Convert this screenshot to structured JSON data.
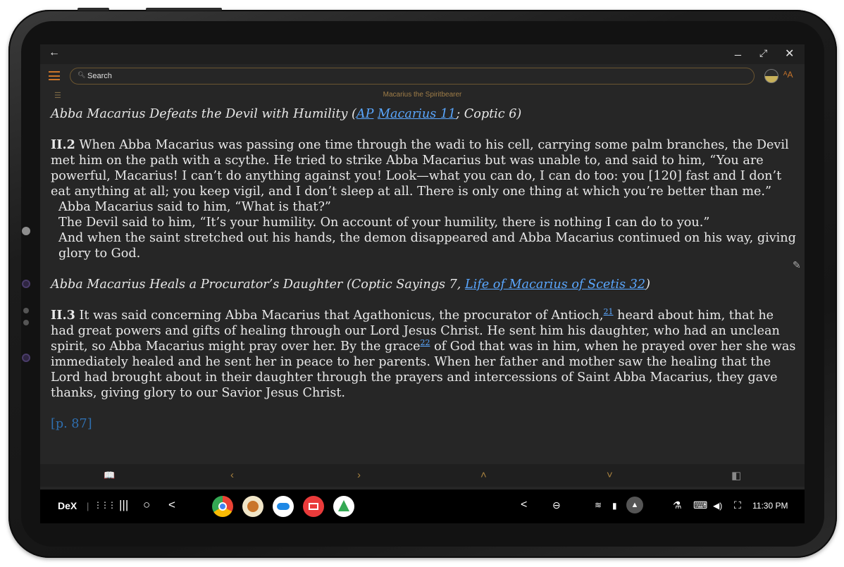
{
  "app": {
    "back_icon": "←",
    "window_buttons": {
      "minimize": "_",
      "maximize": "⤢",
      "close": "✕"
    },
    "search_placeholder": "Search",
    "book_title": "Macarius the Spiritbearer"
  },
  "sections": [
    {
      "heading_pre": "Abba Macarius Defeats the Devil with Humility (",
      "link1": "AP",
      "link_sep": " ",
      "link2": "Macarius 11",
      "heading_post": "; Coptic 6)",
      "para_num": "II.2",
      "para_body": " When Abba Macarius was passing one time through the wadi to his cell, carrying some palm branches, the Devil met him on the path with a scythe. He tried to strike Abba Macarius but was unable to, and said to him, “You are powerful, Macarius! I can’t do anything against you! Look—what you can do, I can do too: you [120] fast and I don’t eat anything at all; you keep vigil, and I don’t sleep at all. There is only one thing at which you’re better than me.”",
      "line2": "Abba Macarius said to him, “What is that?”",
      "line3": "The Devil said to him, “It’s your humility. On account of your humility, there is nothing I can do to you.”",
      "line4": "And when the saint stretched out his hands, the demon disappeared and Abba Macarius continued on his way, giving glory to God."
    },
    {
      "heading_pre": "Abba Macarius Heals a Procurator’s Daughter (Coptic Sayings 7, ",
      "link": "Life of Macarius of Scetis 32",
      "heading_post": ")",
      "para_num": "II.3",
      "body_a": " It was said concerning Abba Macarius that Agathonicus, the procurator of Antioch,",
      "fn1": "21",
      "body_b": " heard about him, that he had great powers and gifts of healing through our Lord Jesus Christ. He sent him his daughter, who had an unclean spirit, so Abba Macarius might pray over her. By the grace",
      "fn2": "22",
      "body_c": " of God that was in him, when he prayed over her she was immediately healed and he sent her in peace to her parents. When her father and mother saw the healing that the Lord had brought about in their daughter through the prayers and intercessions of Saint Abba Macarius, they gave thanks, giving glory to our Savior Jesus Christ."
    }
  ],
  "page_ref": "[p. 87]",
  "bottom_nav": {
    "book": "📖",
    "prev": "‹",
    "next": "›",
    "up": "˄",
    "down": "˅",
    "panel": "◧"
  },
  "taskbar": {
    "dex_label": "DeX",
    "apps_icon": "⋮⋮⋮",
    "recents_icon": "|||",
    "home_icon": "○",
    "back_icon": "<",
    "tray_back": "<",
    "tray_minus": "⊖",
    "wifi": "≋",
    "battery": "▮",
    "notif": "▲",
    "lab": "⚗",
    "keyboard": "⌨",
    "volume": "◀)",
    "screenshot": "⛶",
    "time": "11:30 PM"
  },
  "colors": {
    "accent": "#c9752a",
    "link": "#5aa7ff",
    "background": "#262626",
    "text": "#e8e8e8"
  },
  "icons": [
    "back-arrow-icon",
    "hamburger-menu-icon",
    "search-icon",
    "theme-toggle-icon",
    "font-size-icon",
    "toc-icon",
    "book-icon",
    "chrome-icon",
    "app-icon",
    "cloud-icon",
    "mail-icon",
    "photos-icon"
  ]
}
